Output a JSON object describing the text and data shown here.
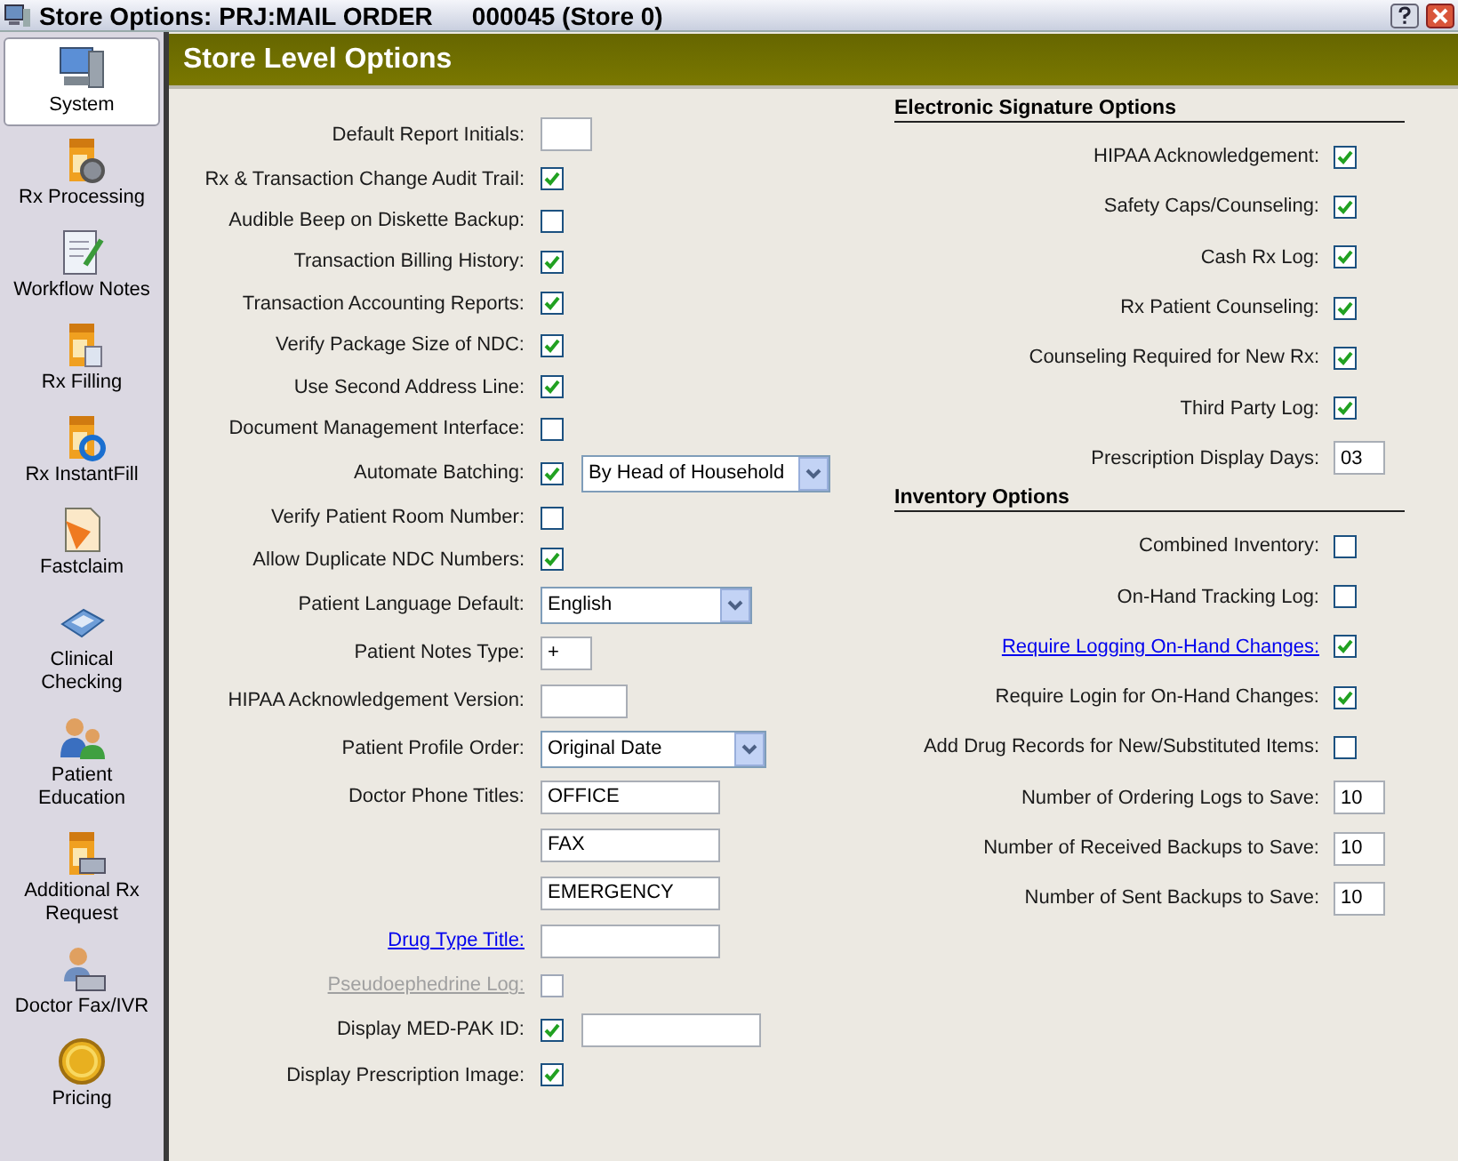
{
  "window": {
    "title": "Store Options: PRJ:MAIL ORDER",
    "store": "000045 (Store 0)"
  },
  "sidebar": {
    "items": [
      {
        "label": "System",
        "selected": true
      },
      {
        "label": "Rx Processing",
        "selected": false
      },
      {
        "label": "Workflow Notes",
        "selected": false
      },
      {
        "label": "Rx Filling",
        "selected": false
      },
      {
        "label": "Rx InstantFill",
        "selected": false
      },
      {
        "label": "Fastclaim",
        "selected": false
      },
      {
        "label": "Clinical\nChecking",
        "selected": false
      },
      {
        "label": "Patient\nEducation",
        "selected": false
      },
      {
        "label": "Additional Rx\nRequest",
        "selected": false
      },
      {
        "label": "Doctor Fax/IVR",
        "selected": false
      },
      {
        "label": "Pricing",
        "selected": false
      }
    ]
  },
  "header": "Store Level Options",
  "left_options": [
    {
      "label": "Default Report Initials:",
      "kind": "plain",
      "controls": [
        {
          "kind": "short-input"
        }
      ]
    },
    {
      "label": "Rx & Transaction Change Audit Trail:",
      "kind": "plain",
      "controls": [
        {
          "kind": "checkbox",
          "checked": true
        }
      ]
    },
    {
      "label": "Audible Beep on Diskette Backup:",
      "kind": "plain",
      "controls": [
        {
          "kind": "checkbox",
          "checked": false
        }
      ]
    },
    {
      "label": "Transaction Billing History:",
      "kind": "plain",
      "controls": [
        {
          "kind": "checkbox",
          "checked": true
        }
      ]
    },
    {
      "label": "Transaction Accounting Reports:",
      "kind": "plain",
      "controls": [
        {
          "kind": "checkbox",
          "checked": true
        }
      ]
    },
    {
      "label": "Verify Package Size of NDC:",
      "kind": "plain",
      "controls": [
        {
          "kind": "checkbox",
          "checked": true
        }
      ]
    },
    {
      "label": "Use Second Address Line:",
      "kind": "plain",
      "controls": [
        {
          "kind": "checkbox",
          "checked": true
        }
      ]
    },
    {
      "label": "Document Management Interface:",
      "kind": "plain",
      "controls": [
        {
          "kind": "checkbox",
          "checked": false
        }
      ]
    },
    {
      "label": "Automate Batching:",
      "kind": "plain",
      "controls": [
        {
          "kind": "checkbox",
          "checked": true
        },
        {
          "kind": "wide-select",
          "value": "By Head of Household"
        }
      ]
    },
    {
      "label": "Verify Patient Room Number:",
      "kind": "plain",
      "controls": [
        {
          "kind": "checkbox",
          "checked": false
        }
      ]
    },
    {
      "label": "Allow Duplicate NDC Numbers:",
      "kind": "plain",
      "controls": [
        {
          "kind": "checkbox",
          "checked": true
        }
      ]
    },
    {
      "label": "Patient Language Default:",
      "kind": "plain",
      "controls": [
        {
          "kind": "select",
          "value": "English"
        }
      ]
    },
    {
      "label": "Patient Notes Type:",
      "kind": "plain",
      "controls": [
        {
          "kind": "short-input",
          "value": "+"
        }
      ]
    },
    {
      "label": "HIPAA Acknowledgement Version:",
      "kind": "plain",
      "controls": [
        {
          "kind": "mid-input"
        }
      ]
    },
    {
      "label": "Patient Profile Order:",
      "kind": "plain",
      "controls": [
        {
          "kind": "wide-select",
          "value": "Original Date"
        }
      ]
    },
    {
      "label": "Doctor Phone Titles:",
      "kind": "plain",
      "controls": [
        {
          "kind": "input",
          "value": "OFFICE"
        }
      ]
    },
    {
      "controls": [
        {
          "kind": "input",
          "value": "FAX"
        }
      ]
    },
    {
      "controls": [
        {
          "kind": "input",
          "value": "EMERGENCY"
        }
      ]
    },
    {
      "label": "Drug Type Title:",
      "kind": "link",
      "controls": [
        {
          "kind": "input"
        }
      ]
    },
    {
      "label": "Pseudoephedrine Log:",
      "kind": "disabled",
      "controls": [
        {
          "kind": "disabled-checkbox",
          "checked": false
        }
      ]
    },
    {
      "label": "Display MED-PAK ID:",
      "kind": "plain",
      "controls": [
        {
          "kind": "checkbox",
          "checked": true
        },
        {
          "kind": "input"
        }
      ]
    },
    {
      "label": "Display Prescription Image:",
      "kind": "plain",
      "controls": [
        {
          "kind": "checkbox",
          "checked": true
        }
      ]
    }
  ],
  "sections": [
    {
      "title": "Electronic Signature Options",
      "options": [
        {
          "label": "HIPAA Acknowledgement:",
          "kind": "plain",
          "controls": [
            {
              "kind": "checkbox",
              "checked": true
            }
          ]
        },
        {
          "label": "Safety Caps/Counseling:",
          "kind": "plain",
          "controls": [
            {
              "kind": "checkbox",
              "checked": true
            }
          ]
        },
        {
          "label": "Cash Rx Log:",
          "kind": "plain",
          "controls": [
            {
              "kind": "checkbox",
              "checked": true
            }
          ]
        },
        {
          "label": "Rx Patient Counseling:",
          "kind": "plain",
          "controls": [
            {
              "kind": "checkbox",
              "checked": true
            }
          ]
        },
        {
          "label": "Counseling Required for New Rx:",
          "kind": "plain",
          "controls": [
            {
              "kind": "checkbox",
              "checked": true
            }
          ]
        },
        {
          "label": "Third Party Log:",
          "kind": "plain",
          "controls": [
            {
              "kind": "checkbox",
              "checked": true
            }
          ]
        },
        {
          "label": "Prescription Display Days:",
          "kind": "plain",
          "controls": [
            {
              "kind": "short-input",
              "value": "03"
            }
          ]
        }
      ]
    },
    {
      "title": "Inventory Options",
      "options": [
        {
          "label": "Combined Inventory:",
          "kind": "plain",
          "controls": [
            {
              "kind": "checkbox",
              "checked": false
            }
          ]
        },
        {
          "label": "On-Hand Tracking Log:",
          "kind": "plain",
          "controls": [
            {
              "kind": "checkbox",
              "checked": false
            }
          ]
        },
        {
          "label": "Require Logging On-Hand Changes:",
          "kind": "link",
          "controls": [
            {
              "kind": "checkbox",
              "checked": true
            }
          ]
        },
        {
          "label": "Require Login for On-Hand Changes:",
          "kind": "plain",
          "controls": [
            {
              "kind": "checkbox",
              "checked": true
            }
          ]
        },
        {
          "label": "Add Drug Records for New/Substituted Items:",
          "kind": "plain",
          "controls": [
            {
              "kind": "checkbox",
              "checked": false
            }
          ]
        },
        {
          "label": "Number of Ordering Logs to Save:",
          "kind": "plain",
          "controls": [
            {
              "kind": "short-input",
              "value": "10"
            }
          ]
        },
        {
          "label": "Number of Received Backups to Save:",
          "kind": "plain",
          "controls": [
            {
              "kind": "short-input",
              "value": "10"
            }
          ]
        },
        {
          "label": "Number of Sent Backups to Save:",
          "kind": "plain",
          "controls": [
            {
              "kind": "short-input",
              "value": "10"
            }
          ]
        }
      ]
    }
  ]
}
